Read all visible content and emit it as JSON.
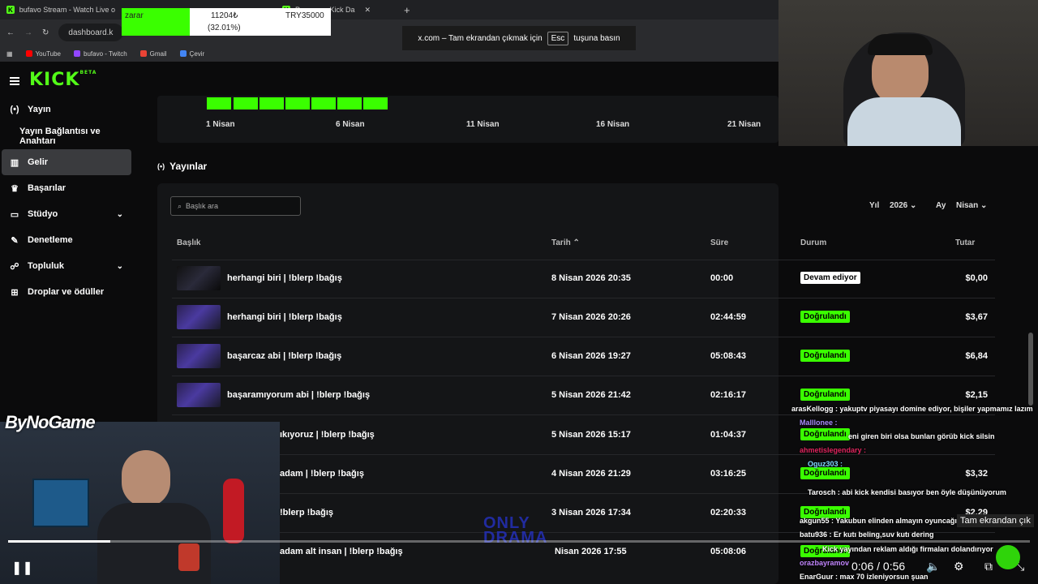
{
  "browser": {
    "tabs": [
      {
        "title": "bufavo Stream - Watch Live o"
      },
      {
        "title": ""
      },
      {
        "title": "Program - Kick Da"
      }
    ],
    "url": "dashboard.k",
    "bookmarks": [
      "YouTube",
      "bufavo - Twitch",
      "Gmail",
      "Çevir"
    ],
    "fullscreen_toast": {
      "prefix": "x.com – Tam ekrandan çıkmak için",
      "key": "Esc",
      "suffix": "tuşuna basın"
    }
  },
  "stock_overlay": {
    "label": "zarar",
    "amount": "11204₺",
    "percent": "(32.01%)",
    "target": "TRY35000"
  },
  "kick": {
    "logo": "KICK",
    "logo_sup": "BETA",
    "sidebar": [
      {
        "label": "Yayın",
        "icon": "broadcast-icon"
      },
      {
        "label": "Yayın Bağlantısı ve Anahtarı",
        "icon": ""
      },
      {
        "label": "Gelir",
        "icon": "chart-icon"
      },
      {
        "label": "Başarılar",
        "icon": "trophy-icon"
      },
      {
        "label": "Stüdyo",
        "icon": "studio-icon"
      },
      {
        "label": "Denetleme",
        "icon": "wrench-icon"
      },
      {
        "label": "Topluluk",
        "icon": "community-icon"
      },
      {
        "label": "Droplar ve ödüller",
        "icon": "gift-icon"
      }
    ],
    "calendar_labels": [
      "1 Nisan",
      "6 Nisan",
      "11 Nisan",
      "16 Nisan",
      "21 Nisan"
    ],
    "section_title": "Yayınlar",
    "search_placeholder": "Başlık ara",
    "filters": {
      "year_label": "Yıl",
      "year_value": "2026",
      "month_label": "Ay",
      "month_value": "Nisan"
    },
    "columns": {
      "title": "Başlık",
      "date": "Tarih",
      "duration": "Süre",
      "status": "Durum",
      "amount": "Tutar"
    },
    "rows": [
      {
        "title": "herhangi biri | !blerp !bağış",
        "date": "8 Nisan 2026 20:35",
        "duration": "00:00",
        "status": "Devam ediyor",
        "amount": "$0,00"
      },
      {
        "title": "herhangi biri | !blerp !bağış",
        "date": "7 Nisan 2026 20:26",
        "duration": "02:44:59",
        "status": "Doğrulandı",
        "amount": "$3,67"
      },
      {
        "title": "başarcaz abi | !blerp !bağış",
        "date": "6 Nisan 2026 19:27",
        "duration": "05:08:43",
        "status": "Doğrulandı",
        "amount": "$6,84"
      },
      {
        "title": "başaramıyorum abi | !blerp !bağış",
        "date": "5 Nisan 2026 21:42",
        "duration": "02:16:17",
        "status": "Doğrulandı",
        "amount": "$2,15"
      },
      {
        "title": "ıkıyoruz | !blerp !bağış",
        "date": "5 Nisan 2026 15:17",
        "duration": "01:04:37",
        "status": "Doğrulandı",
        "amount": ""
      },
      {
        "title": "adam | !blerp !bağış",
        "date": "4 Nisan 2026 21:29",
        "duration": "03:16:25",
        "status": "Doğrulandı",
        "amount": "$3,32"
      },
      {
        "title": "!blerp !bağış",
        "date": "3 Nisan 2026 17:34",
        "duration": "02:20:33",
        "status": "Doğrulandı",
        "amount": "$2,29"
      },
      {
        "title": "adam alt insan | !blerp !bağış",
        "date": "Nisan 2026 17:55",
        "duration": "05:08:06",
        "status": "Doğrulandı",
        "amount": ""
      }
    ]
  },
  "overlay": {
    "bynogame": "ByNoGame",
    "onlydrama": "ONLY DRAMA",
    "time": "0:06 / 0:56",
    "tooltip": "Tam ekrandan çık",
    "progress": 0.1,
    "chat": [
      "arasKellogg : yakuptv piyasayı domine ediyor, bişiler yapmamız lazım",
      "Malllonee :",
      "eni giren biri olsa bunları görüb kick silsin",
      "ahmetislegendary :",
      "Oguz303 :",
      "Tarosch : abi kick kendisi basıyor ben öyle düşünüyorum",
      "akgun55 : Yakubun elinden almayın oyuncağı",
      "batu936 : Er kutı beling,suv kutı dering",
      "Kick yayından reklam aldığı firmaları dolandırıyor",
      "orazbayramov",
      "EnarGuur : max 70 izleniyorsun şuan"
    ]
  }
}
